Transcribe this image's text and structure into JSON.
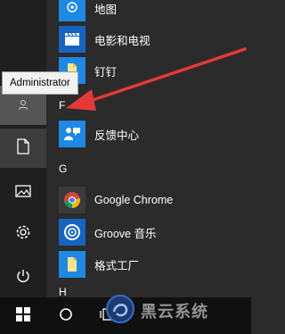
{
  "start_menu": {
    "rail": {
      "user_tooltip": "Administrator"
    },
    "apps": [
      {
        "label": "地图",
        "icon": "map-icon",
        "color": "#1e88e5"
      },
      {
        "label": "电影和电视",
        "icon": "film-icon",
        "color": "#1565c0"
      },
      {
        "label": "钉钉",
        "icon": "dingtalk-icon",
        "color": "#1e88e5"
      },
      {
        "label": "反馈中心",
        "icon": "feedback-icon",
        "color": "#1e88e5"
      },
      {
        "label": "Google Chrome",
        "icon": "chrome-icon",
        "color": "#333333"
      },
      {
        "label": "Groove 音乐",
        "icon": "groove-icon",
        "color": "#1565c0"
      },
      {
        "label": "格式工厂",
        "icon": "formatfactory-icon",
        "color": "#1e88e5"
      }
    ],
    "letters": [
      "F",
      "G",
      "H"
    ]
  },
  "colors": {
    "accent": "#1e88e5",
    "arrow": "#e53935",
    "rail": "#1f1f1f",
    "list": "#2b2b2b"
  },
  "watermark": {
    "text": "黑云系统"
  }
}
